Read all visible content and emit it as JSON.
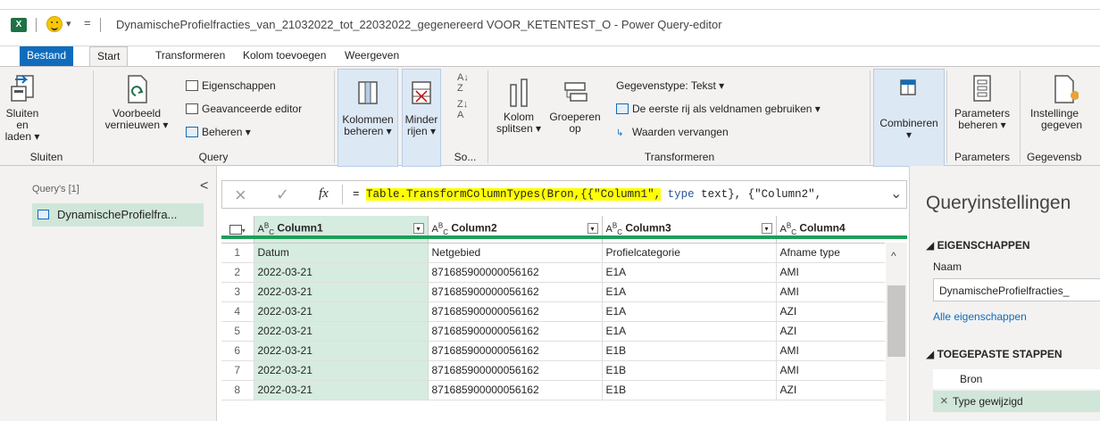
{
  "titlebar": {
    "qat_arrow": "▾",
    "qat_customize": "=",
    "title": "DynamischeProfielfracties_van_21032022_tot_22032022_gegenereerd VOOR_KETENTEST_O - Power Query-editor"
  },
  "tabs": [
    "Bestand",
    "Start",
    "Transformeren",
    "Kolom toevoegen",
    "Weergeven"
  ],
  "ribbon": {
    "close_load": [
      "Sluiten en",
      "laden ▾"
    ],
    "preview_refresh": [
      "Voorbeeld",
      "vernieuwen ▾"
    ],
    "properties": "Eigenschappen",
    "advanced_editor": "Geavanceerde editor",
    "manage": "Beheren ▾",
    "manage_columns": [
      "Kolommen",
      "beheren ▾"
    ],
    "reduce_rows": [
      "Minder",
      "rijen ▾"
    ],
    "sort_group": "So...",
    "split_column": [
      "Kolom",
      "splitsen ▾"
    ],
    "group_by": [
      "Groeperen",
      "op"
    ],
    "data_type": "Gegevenstype: Tekst ▾",
    "first_row_headers": "De eerste rij als veldnamen gebruiken ▾",
    "replace_values": "Waarden vervangen",
    "combine": [
      "Combineren",
      "▾"
    ],
    "manage_parameters": [
      "Parameters",
      "beheren ▾"
    ],
    "data_source_settings": [
      "Instellinge",
      "gegeven"
    ],
    "groups": {
      "close": "Sluiten",
      "query": "Query",
      "transform": "Transformeren",
      "parameters": "Parameters",
      "datasource": "Gegevensb"
    }
  },
  "left_pane": {
    "header": "Query's [1]",
    "collapse": "<",
    "query_name": "DynamischeProfielfra..."
  },
  "formula_bar": {
    "cancel": "×",
    "commit": "✓",
    "fx": "fx",
    "eq": "=",
    "highlighted": "Table.TransformColumnTypes(Bron,{{\"Column1\",",
    "rest_type": "type",
    "rest_text": "text}, {\"Column2\",",
    "expand": "⌄"
  },
  "grid": {
    "type_prefix": "A",
    "type_sup": "B",
    "type_sub": "C",
    "dropdown": "▾",
    "columns": [
      "Column1",
      "Column2",
      "Column3",
      "Column4"
    ],
    "rows": [
      [
        "1",
        "Datum",
        "Netgebied",
        "Profielcategorie",
        "Afname type"
      ],
      [
        "2",
        "2022-03-21",
        "871685900000056162",
        "E1A",
        "AMI"
      ],
      [
        "3",
        "2022-03-21",
        "871685900000056162",
        "E1A",
        "AMI"
      ],
      [
        "4",
        "2022-03-21",
        "871685900000056162",
        "E1A",
        "AZI"
      ],
      [
        "5",
        "2022-03-21",
        "871685900000056162",
        "E1A",
        "AZI"
      ],
      [
        "6",
        "2022-03-21",
        "871685900000056162",
        "E1B",
        "AMI"
      ],
      [
        "7",
        "2022-03-21",
        "871685900000056162",
        "E1B",
        "AMI"
      ],
      [
        "8",
        "2022-03-21",
        "871685900000056162",
        "E1B",
        "AZI"
      ]
    ]
  },
  "right_pane": {
    "title": "Queryinstellingen",
    "properties_header": "◢ EIGENSCHAPPEN",
    "name_label": "Naam",
    "name_value": "DynamischeProfielfracties_",
    "all_properties": "Alle eigenschappen",
    "steps_header": "◢ TOEGEPASTE STAPPEN",
    "steps": [
      "Bron",
      "Type gewijzigd"
    ],
    "step_delete": "×"
  },
  "colors": {
    "file_tab": "#0f6cbd",
    "selected_column": "#d6ece0",
    "formula_highlight": "#ffff00",
    "selected_query": "#cfe6d9"
  }
}
